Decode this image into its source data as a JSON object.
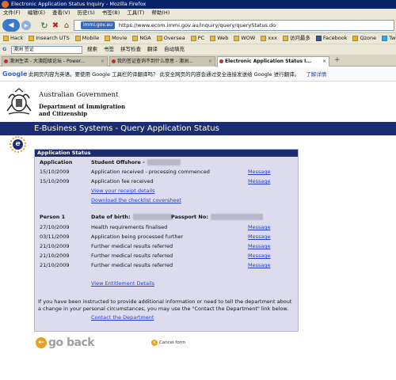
{
  "window": {
    "title": "Electronic Application Status Inquiry - Mozilla Firefox"
  },
  "menu": [
    "文件(F)",
    "编辑(E)",
    "查看(V)",
    "历史(S)",
    "书签(B)",
    "工具(T)",
    "帮助(H)"
  ],
  "address": {
    "site_badge": "immi.gov.au",
    "url": "https://www.ecom.immi.gov.au/inquiry/query/queryStatus.do"
  },
  "bookmarks": [
    "Hack",
    "Insearch UTS",
    "Mobile",
    "Movie",
    "NGA",
    "Oversea",
    "PC",
    "Web",
    "WOW",
    "xxx",
    "访问最多",
    "Facebook",
    "Qzone",
    "Twitt"
  ],
  "google_bar": {
    "search_value": "澳洲 签证",
    "items": [
      "搜索",
      "书签",
      "拼写检查",
      "翻译",
      "自动填充"
    ]
  },
  "tabs": [
    {
      "label": "澳洲生活 - 大澳超级论坛 - Power..."
    },
    {
      "label": "我的签证查询不到什么意思 - 澳洲..."
    },
    {
      "label": "Electronic Application Status I..."
    }
  ],
  "translate_bar": {
    "logo": "Google",
    "text": "此网页内容为英语。要使用 Google 工具栏的译翻译吗？ 此安全网页的内容会通过安全连接发送给 Google 进行翻译。",
    "link": "了解详情"
  },
  "header": {
    "gov": "Australian Government",
    "dept": "Department of Immigration and Citizenship"
  },
  "banner": "E-Business Systems - Query Application Status",
  "badge": "e",
  "status": {
    "title": "Application Status",
    "col_application": "Application",
    "col_applicant": "Student Offshore -",
    "app_rows": [
      {
        "date": "15/10/2009",
        "text": "Application received - processing commenced",
        "link": "Message"
      },
      {
        "date": "15/10/2009",
        "text": "Application fee received",
        "link": "Message"
      }
    ],
    "receipt_link": "View your receipt details",
    "checklist_link": "Download the checklist coversheet",
    "person_label": "Person 1",
    "dob_label": "Date of birth:",
    "passport_label": "Passport No:",
    "person_rows": [
      {
        "date": "27/10/2009",
        "text": "Health requirements finalised",
        "link": "Message"
      },
      {
        "date": "03/11/2009",
        "text": "Application being processed further",
        "link": "Message"
      },
      {
        "date": "21/10/2009",
        "text": "Further medical results referred",
        "link": "Message"
      },
      {
        "date": "21/10/2009",
        "text": "Further medical results referred",
        "link": "Message"
      },
      {
        "date": "21/10/2009",
        "text": "Further medical results referred",
        "link": "Message"
      }
    ],
    "entitlement_link": "View Entitlement Details",
    "notice": "If you have been instructed to provide additional information or need to tell the department about a change in your personal circumstances, you may use the \"Contact the Department\" link below.",
    "contact_link": "Contact the Department"
  },
  "footer": {
    "go_back": "go back",
    "cancel": "Cancel form"
  }
}
